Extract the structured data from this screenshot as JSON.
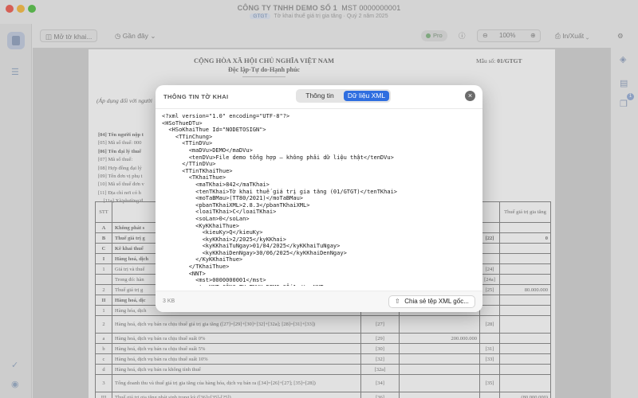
{
  "window": {
    "title": "CÔNG TY TNHH DEMO SỐ 1",
    "mst": "MST 0000000001",
    "tag": "GTGT",
    "subtitle": "Tờ khai thuế giá trị gia tăng · Quý 2 năm 2025"
  },
  "toolbar": {
    "open_label": "Mở tờ khai...",
    "recent_label": "Gần đây",
    "pro_label": "Pro",
    "zoom_value": "100%",
    "print_export_label": "In/Xuất"
  },
  "document": {
    "heading1": "CỘNG HÒA XÃ HỘI CHỦ NGHĨA VIỆT NAM",
    "heading2": "Độc lập-Tự do-Hạnh phúc",
    "heading_dash": "---------------------------",
    "form_label": "Mẫu số:",
    "form_number": "01/GTGT",
    "note": "(Áp dụng đối với người",
    "lines": [
      "[04] Tên người nộp t",
      "[05] Mã số thuế: 000",
      "[06] Tên đại lý thuế",
      "[07] Mã số thuế:",
      "[08] Hợp đồng đại lý",
      "[09] Tên đơn vị phụ t",
      "[10] Mã số thuế đơn v",
      "[11] Địa chỉ nơi có h",
      "    [11a] Xã/phường/đ"
    ],
    "table": {
      "header": {
        "stt": "STT",
        "col5": "Thuế giá trị gia tăng"
      },
      "rows": [
        {
          "stt": "A",
          "text": "Không phát s",
          "code": "",
          "value": "",
          "code2": "",
          "value2": "",
          "bold": true
        },
        {
          "stt": "B",
          "text": "Thuế giá trị g",
          "code": "",
          "value": "",
          "code2": "[22]",
          "value2": "0",
          "bold": true
        },
        {
          "stt": "C",
          "text": "Kê khai thuế",
          "code": "",
          "value": "",
          "code2": "",
          "value2": "",
          "bold": true
        },
        {
          "stt": "I",
          "text": "Hàng hoá, dịch",
          "code": "",
          "value": "",
          "code2": "",
          "value2": "",
          "bold": true
        },
        {
          "stt": "1",
          "text": "Giá trị và thuế",
          "code": "",
          "value": "",
          "code2": "[24]",
          "value2": "",
          "bold": false
        },
        {
          "stt": "",
          "text": "Trong đó: hàn",
          "code": "",
          "value": "",
          "code2": "[24a]",
          "value2": "",
          "bold": false
        },
        {
          "stt": "2",
          "text": "Thuế giá trị g",
          "code": "",
          "value": "",
          "code2": "[25]",
          "value2": "80.000.000",
          "bold": false
        },
        {
          "stt": "II",
          "text": "Hàng hoá, dịc",
          "code": "",
          "value": "",
          "code2": "",
          "value2": "",
          "bold": true
        },
        {
          "stt": "1",
          "text": "Hàng hóa, dịch",
          "code": "",
          "value": "",
          "code2": "",
          "value2": "",
          "bold": false
        },
        {
          "stt": "2",
          "text": "Hàng hoá, dịch vụ bán ra chịu thuế giá trị gia tăng ([27]=[29]+[30]+[32]+[32a]; [28]=[31]+[33])",
          "code": "[27]",
          "value": "",
          "code2": "[28]",
          "value2": "",
          "bold": false,
          "tall": true
        },
        {
          "stt": "a",
          "text": "Hàng hoá, dịch vụ bán ra chịu thuế suất 0%",
          "code": "[29]",
          "value": "200.000.000",
          "code2": "",
          "value2": "",
          "bold": false
        },
        {
          "stt": "b",
          "text": "Hàng hoá, dịch vụ bán ra chịu thuế suất 5%",
          "code": "[30]",
          "value": "",
          "code2": "[31]",
          "value2": "",
          "bold": false
        },
        {
          "stt": "c",
          "text": "Hàng hoá, dịch vụ bán ra chịu thuế suất 10%",
          "code": "[32]",
          "value": "",
          "code2": "[33]",
          "value2": "",
          "bold": false
        },
        {
          "stt": "d",
          "text": "Hàng hoá, dịch vụ bán ra không tính thuế",
          "code": "[32a]",
          "value": "",
          "code2": "",
          "value2": "",
          "bold": false
        },
        {
          "stt": "3",
          "text": "Tổng doanh thu và thuế giá trị gia tăng của hàng hóa, dịch vụ bán ra ([34]=[26]+[27]; [35]=[28])",
          "code": "[34]",
          "value": "",
          "code2": "[35]",
          "value2": "",
          "bold": false,
          "tall": true
        },
        {
          "stt": "III",
          "text": "Thuế giá trị gia tăng phát sinh trong kỳ ([36]=[35]-[25])",
          "code": "[36]",
          "value": "",
          "code2": "",
          "value2": "(80.000.000)",
          "bold": false
        }
      ]
    }
  },
  "modal": {
    "title": "THÔNG TIN TỜ KHAI",
    "tab_info": "Thông tin",
    "tab_xml": "Dữ liệu XML",
    "xml_text": "<?xml version=\"1.0\" encoding=\"UTF-8\"?>\n<HSoThueDTu>\n  <HSoKhaiThue Id=\"NODETOSIGN\">\n    <TTinChung>\n      <TTinDVu>\n        <maDVu>DEMO</maDVu>\n        <tenDVu>File demo tổng hợp — không phải dữ liệu thật</tenDVu>\n      </TTinDVu>\n      <TTinTKhaiThue>\n        <TKhaiThue>\n          <maTKhai>842</maTKhai>\n          <tenTKhai>Tờ khai thuế giá trị gia tăng (01/GTGT)</tenTKhai>\n          <moTaBMau>(TT80/2021)</moTaBMau>\n          <pbanTKhaiXML>2.8.3</pbanTKhaiXML>\n          <loaiTKhai>C</loaiTKhai>\n          <soLan>0</soLan>\n          <KyKKhaiThue>\n            <kieuKy>Q</kieuKy>\n            <kyKKhai>2/2025</kyKKhai>\n            <kyKKhaiTuNgay>01/04/2025</kyKKhaiTuNgay>\n            <kyKKhaiDenNgay>30/06/2025</kyKKhaiDenNgay>\n          </KyKKhaiThue>\n        </TKhaiThue>\n        <NNT>\n          <mst>0000000001</mst>\n          <tenNNT>CÔNG TY TNHH DEMO SỐ 1</tenNNT>\n          <dchiNNT>Số 1 Phố Demo, Phường Demo</dchiNNT>\n          <NNT>",
    "size": "3 KB",
    "share_label": "Chia sẻ tệp XML gốc..."
  }
}
